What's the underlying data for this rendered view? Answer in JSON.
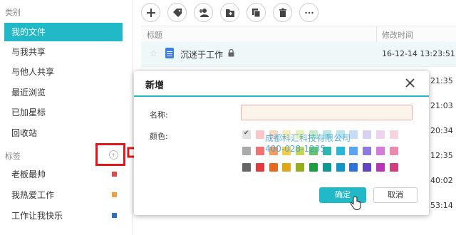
{
  "sidebar": {
    "category_title": "类别",
    "items": [
      {
        "label": "我的文件",
        "active": true
      },
      {
        "label": "与我共享"
      },
      {
        "label": "与他人共享"
      },
      {
        "label": "最近浏览"
      },
      {
        "label": "已加星标"
      },
      {
        "label": "回收站"
      }
    ],
    "tags_title": "标签",
    "tags": [
      {
        "label": "老板最帅",
        "color": "#e04848"
      },
      {
        "label": "我热爱工作",
        "color": "#f0a040"
      },
      {
        "label": "工作让我快乐",
        "color": "#2c6fc9"
      }
    ]
  },
  "toolbar": {
    "icons": [
      "plus-icon",
      "tag-icon",
      "add-user-icon",
      "move-to-folder-icon",
      "copy-icon",
      "delete-icon",
      "more-icon"
    ]
  },
  "list": {
    "header_title": "标题",
    "header_time": "修改时间",
    "rows": [
      {
        "name": "沉迷于工作",
        "time": "16-12-14 13:23:51",
        "locked": true
      }
    ],
    "partial_times": [
      "21:35",
      "21:03",
      "20:34",
      "12:35",
      "40:02",
      "53:14"
    ]
  },
  "modal": {
    "title": "新增",
    "name_label": "名称:",
    "name_value": "",
    "color_label": "颜色:",
    "selected_color": "#e3e3e3",
    "colors": [
      [
        "#e3e3e3",
        "#f9c7c7",
        "#fbd8c0",
        "#fcedb8",
        "#e8f0b8",
        "#c7ebc4",
        "#b8e6e0",
        "#bde3ef",
        "#c7dcf5",
        "#d8d0f2",
        "#eed3ef",
        "#f7d3df"
      ],
      [
        "#aaaaaa",
        "#f07272",
        "#f59b5f",
        "#f3cc4a",
        "#c6d55a",
        "#63c56b",
        "#2ab8b0",
        "#29b6d9",
        "#5ba4ef",
        "#8d7ae0",
        "#d47dd8",
        "#ee88b0"
      ],
      [
        "#666666",
        "#e23b3b",
        "#e46c1e",
        "#e0a815",
        "#98ad1c",
        "#1e9e3e",
        "#0a9a92",
        "#1294c4",
        "#2f72d8",
        "#6142c9",
        "#b437b8",
        "#d43d7e"
      ]
    ],
    "watermark_line1": "成都科汇科技有限公司",
    "watermark_line2": "400-028-1235",
    "ok_label": "确定",
    "cancel_label": "取消"
  }
}
